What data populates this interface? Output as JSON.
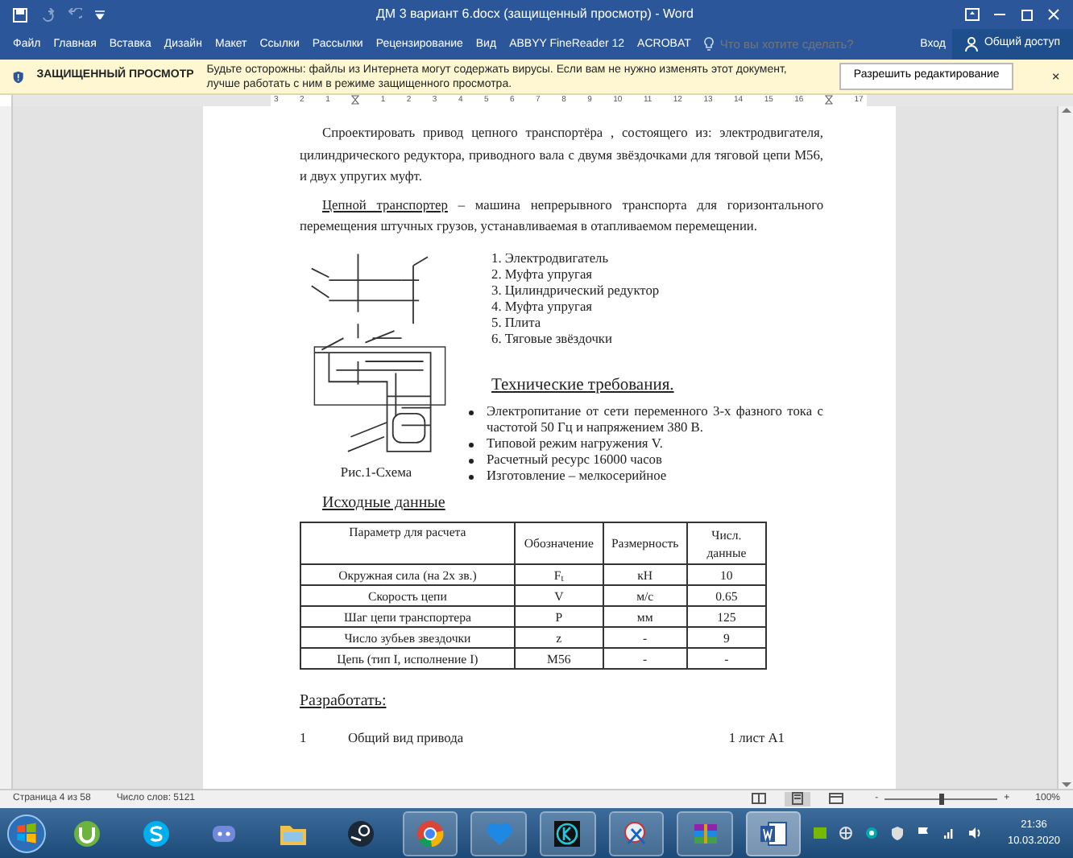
{
  "window": {
    "title": "ДМ 3 вариант 6.docx (защищенный просмотр) - Word"
  },
  "ribbon_tabs": [
    {
      "label": "Файл",
      "selected": false
    },
    {
      "label": "Главная",
      "selected": false
    },
    {
      "label": "Вставка",
      "selected": false
    },
    {
      "label": "Дизайн",
      "selected": false
    },
    {
      "label": "Макет",
      "selected": false
    },
    {
      "label": "Ссылки",
      "selected": false
    },
    {
      "label": "Рассылки",
      "selected": false
    },
    {
      "label": "Рецензирование",
      "selected": false
    },
    {
      "label": "Вид",
      "selected": false
    },
    {
      "label": "ABBYY FineReader 12",
      "selected": false
    },
    {
      "label": "ACROBAT",
      "selected": false
    }
  ],
  "tell_me": {
    "placeholder": "Что вы хотите сделать?"
  },
  "sign_in": "Вход",
  "share": "Общий доступ",
  "protected_view": {
    "title": "ЗАЩИЩЕННЫЙ ПРОСМОТР",
    "message": "Будьте осторожны: файлы из Интернета могут содержать вирусы. Если вам не нужно изменять этот документ, лучше работать с ним в режиме защищенного просмотра.",
    "button": "Разрешить редактирование"
  },
  "ruler": {
    "marks": [
      {
        "kind": "number",
        "label": "3"
      },
      {
        "kind": "number",
        "label": "2"
      },
      {
        "kind": "number",
        "label": "1"
      },
      {
        "kind": "indent"
      },
      {
        "kind": "number",
        "label": "1"
      },
      {
        "kind": "number",
        "label": "2"
      },
      {
        "kind": "number",
        "label": "3"
      },
      {
        "kind": "number",
        "label": "4"
      },
      {
        "kind": "number",
        "label": "5"
      },
      {
        "kind": "number",
        "label": "6"
      },
      {
        "kind": "number",
        "label": "7"
      },
      {
        "kind": "number",
        "label": "8"
      },
      {
        "kind": "number",
        "label": "9"
      },
      {
        "kind": "number",
        "label": "10"
      },
      {
        "kind": "number",
        "label": "11"
      },
      {
        "kind": "number",
        "label": "12"
      },
      {
        "kind": "number",
        "label": "13"
      },
      {
        "kind": "number",
        "label": "14"
      },
      {
        "kind": "number",
        "label": "15"
      },
      {
        "kind": "number",
        "label": "16"
      },
      {
        "kind": "indent"
      },
      {
        "kind": "number",
        "label": "17"
      }
    ]
  },
  "document": {
    "intro": "Спроектировать привод цепного транспортёра , состоящего из: электродвигателя, цилиндрического редуктора, приводного вала с двумя звёздочками для тяговой цепи М56, и двух упругих муфт.",
    "definition": {
      "term": "Цепной транспортер",
      "text": " – машина непрерывного транспорта для горизонтального перемещения штучных грузов, устанавливаемая в отапливаемом перемещении."
    },
    "figure_caption": "Рис.1-Схема",
    "components": [
      "1. Электродвигатель",
      "2. Муфта упругая",
      "3. Цилиндрический редуктор",
      "4. Муфта упругая",
      "5. Плита",
      "6. Тяговые звёздочки"
    ],
    "requirements": {
      "title": "Технические требования.",
      "items": [
        "Электропитание от сети переменного 3-х фазного тока с частотой 50 Гц и напряжением 380 В.",
        "Типовой режим нагружения V.",
        "Расчетный ресурс 16000 часов",
        "Изготовление – мелкосерийное"
      ]
    },
    "table": {
      "title": "Исходные данные",
      "columns": [
        "Параметр для расчета",
        "Обозначение",
        "Размерность",
        "Числ. данные"
      ],
      "rows": [
        [
          "Окружная сила (на 2х зв.)",
          "F$_{t}$",
          "кН",
          "10"
        ],
        [
          "Скорость цепи",
          "V",
          "м/с",
          "0.65"
        ],
        [
          "Шаг цепи транспортера",
          "P",
          "мм",
          "125"
        ],
        [
          "Число зубьев звездочки",
          "z",
          "-",
          "9"
        ],
        [
          "Цепь (тип I, исполнение I)",
          "М56",
          "-",
          "-"
        ]
      ]
    },
    "develop": {
      "title": "Разработать:",
      "items": [
        {
          "number": "1",
          "text": "Общий вид привода",
          "sheets": "1 лист А1"
        }
      ]
    }
  },
  "status_bar": {
    "page": "Страница 4 из 58",
    "words": "Число слов: 5121",
    "views": [
      {
        "kind": "read",
        "selected": false
      },
      {
        "kind": "print",
        "selected": true
      },
      {
        "kind": "web",
        "selected": false
      }
    ],
    "zoom_out": "-",
    "zoom_slider": {
      "level": 0.5
    },
    "zoom_in": "+",
    "zoom": "100%"
  },
  "taskbar": {
    "apps": [
      {
        "kind": "utorrent",
        "running": false,
        "selected": false
      },
      {
        "kind": "skype",
        "running": false,
        "selected": false
      },
      {
        "kind": "discord",
        "running": false,
        "selected": false
      },
      {
        "kind": "folder",
        "running": false,
        "selected": false
      },
      {
        "kind": "steam",
        "running": false,
        "selected": false
      },
      {
        "kind": "chrome",
        "running": true,
        "selected": false
      },
      {
        "kind": "heart",
        "running": true,
        "selected": false
      },
      {
        "kind": "kapp",
        "running": true,
        "selected": false
      },
      {
        "kind": "scissors",
        "running": true,
        "selected": false
      },
      {
        "kind": "winrar",
        "running": true,
        "selected": false
      },
      {
        "kind": "word",
        "running": true,
        "selected": true
      }
    ],
    "tray": [
      {
        "kind": "nvidia"
      },
      {
        "kind": "globe"
      },
      {
        "kind": "circle"
      },
      {
        "kind": "shield"
      },
      {
        "kind": "flag"
      },
      {
        "kind": "signal"
      },
      {
        "kind": "volume"
      }
    ],
    "time": "21:36",
    "date": "10.03.2020"
  }
}
